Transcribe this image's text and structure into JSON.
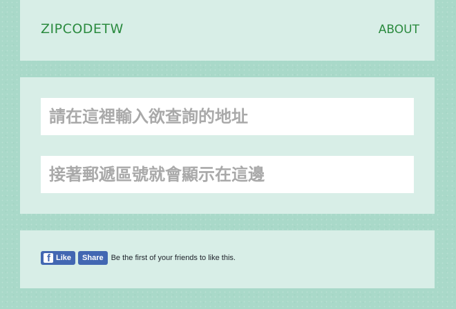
{
  "header": {
    "brand": "ZIPCODETW",
    "about_link": "ABOUT"
  },
  "form": {
    "address_placeholder": "請在這裡輸入欲查詢的地址",
    "zipcode_placeholder": "接著郵遞區號就會顯示在這邊"
  },
  "social": {
    "like_label": "Like",
    "share_label": "Share",
    "friends_text": "Be the first of your friends to like this.",
    "facebook_color": "#4267b2"
  },
  "colors": {
    "background": "#a9d9c9",
    "panel": "#d8eee7",
    "accent": "#2a8a3e"
  }
}
